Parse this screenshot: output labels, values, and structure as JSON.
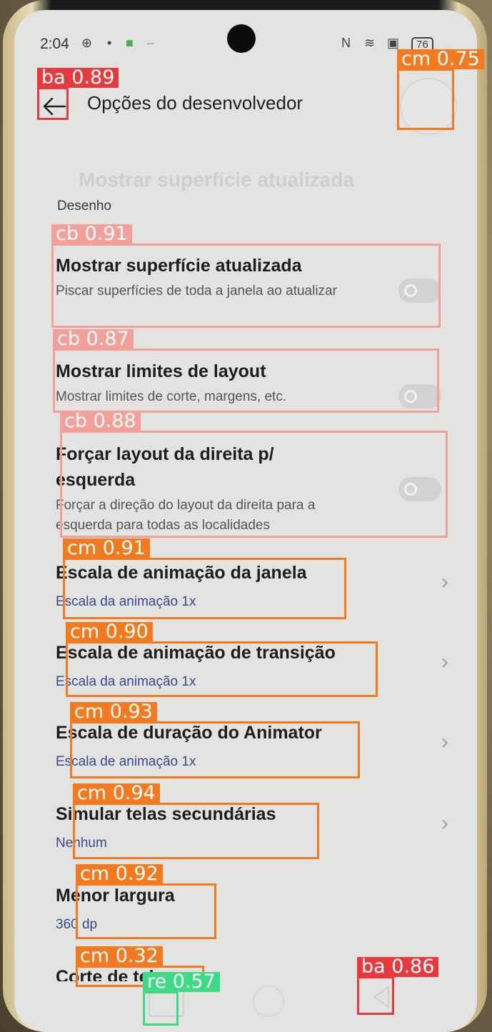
{
  "status": {
    "time": "2:04",
    "battery": "76"
  },
  "appbar": {
    "title": "Opções do desenvolvedor"
  },
  "ghost_text": "Mostrar superfície atualizada",
  "section": "Desenho",
  "items": [
    {
      "title": "Mostrar superfície atualizada",
      "subtitle": "Piscar superfícies de toda a janela ao atualizar",
      "control": "toggle",
      "state": "off"
    },
    {
      "title": "Mostrar limites de layout",
      "subtitle": "Mostrar limites de corte, margens, etc.",
      "control": "toggle",
      "state": "off"
    },
    {
      "title": "Forçar layout da direita p/ esquerda",
      "subtitle": "Forçar a direção do layout da direita para a esquerda para todas as localidades",
      "control": "toggle",
      "state": "off"
    },
    {
      "title": "Escala de animação da janela",
      "value": "Escala da animação 1x",
      "control": "chevron"
    },
    {
      "title": "Escala de animação de transição",
      "value": "Escala da animação 1x",
      "control": "chevron"
    },
    {
      "title": "Escala de duração do Animator",
      "value": "Escala de animação 1x",
      "control": "chevron"
    },
    {
      "title": "Simular telas secundárias",
      "value": "Nenhum",
      "control": "chevron"
    },
    {
      "title": "Menor largura",
      "value": "360 dp",
      "control": "none"
    },
    {
      "title": "Corte de tela",
      "control": "none"
    }
  ],
  "detections": [
    {
      "label": "ba 0.89",
      "color": "#e8393f"
    },
    {
      "label": "cm 0.75",
      "color": "#f47a20"
    },
    {
      "label": "cb 0.91",
      "color": "#f4a09a"
    },
    {
      "label": "cb 0.87",
      "color": "#f4a09a"
    },
    {
      "label": "cb 0.88",
      "color": "#f4a09a"
    },
    {
      "label": "cm 0.91",
      "color": "#f47a20"
    },
    {
      "label": "cm 0.90",
      "color": "#f47a20"
    },
    {
      "label": "cm 0.93",
      "color": "#f47a20"
    },
    {
      "label": "cm 0.94",
      "color": "#f47a20"
    },
    {
      "label": "cm 0.92",
      "color": "#f47a20"
    },
    {
      "label": "cm 0.32",
      "color": "#f47a20"
    },
    {
      "label": "re 0.57",
      "color": "#3ddc84"
    },
    {
      "label": "ba 0.86",
      "color": "#e8393f"
    }
  ]
}
